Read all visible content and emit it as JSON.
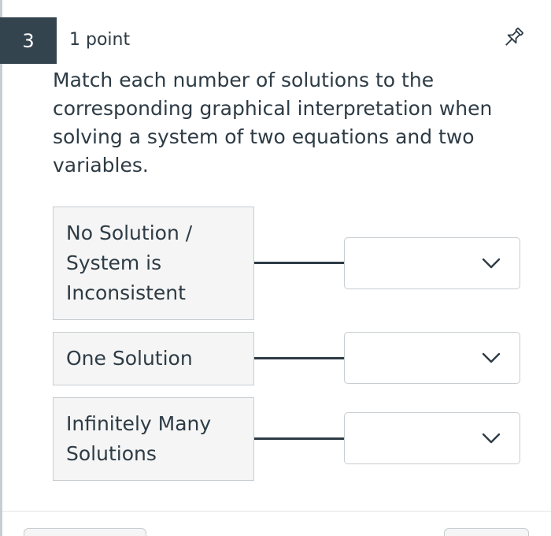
{
  "question": {
    "number": "3",
    "points": "1 point",
    "text": "Match each number of solutions to the corresponding graphical interpretation when solving a system of two equations and two variables.",
    "pin_icon": "pushpin-icon"
  },
  "matches": [
    {
      "prompt": "No Solution / System is Inconsistent",
      "selected": ""
    },
    {
      "prompt": "One Solution",
      "selected": ""
    },
    {
      "prompt": "Infinitely Many Solutions",
      "selected": ""
    }
  ],
  "colors": {
    "number_badge": "#34444f",
    "text": "#2d3b45",
    "border": "#c7cdd1",
    "prompt_bg": "#f5f5f5"
  }
}
